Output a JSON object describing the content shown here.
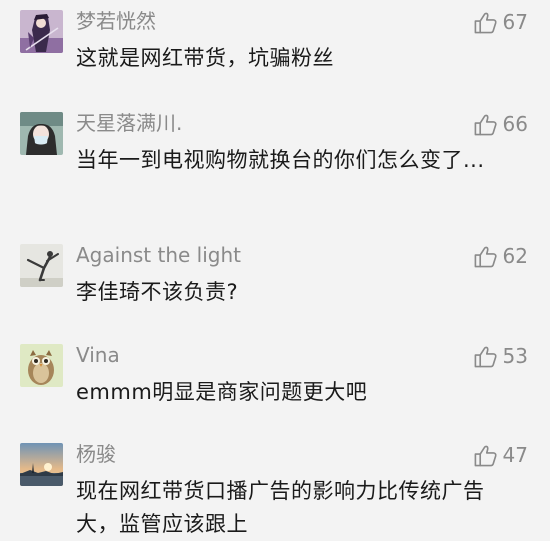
{
  "comments": [
    {
      "name": "梦若恍然",
      "likes": "67",
      "text": "这就是网红带货，坑骗粉丝",
      "avatar": "anime-swordsman-avatar"
    },
    {
      "name": "天星落满川.",
      "likes": "66",
      "text": "当年一到电视购物就换台的你们怎么变了...",
      "avatar": "masked-person-avatar"
    },
    {
      "name": "Against the light",
      "likes": "62",
      "text": "李佳琦不该负责?",
      "avatar": "dancer-silhouette-avatar"
    },
    {
      "name": "Vina",
      "likes": "53",
      "text": "emmm明显是商家问题更大吧",
      "avatar": "owl-avatar"
    },
    {
      "name": "杨骏",
      "likes": "47",
      "text": "现在网红带货口播广告的影响力比传统广告大，监管应该跟上",
      "avatar": "sunset-landscape-avatar"
    }
  ],
  "colors": {
    "background": "#f3f3f3",
    "meta_text": "#8a8a8a",
    "body_text": "#1a1a1a"
  }
}
